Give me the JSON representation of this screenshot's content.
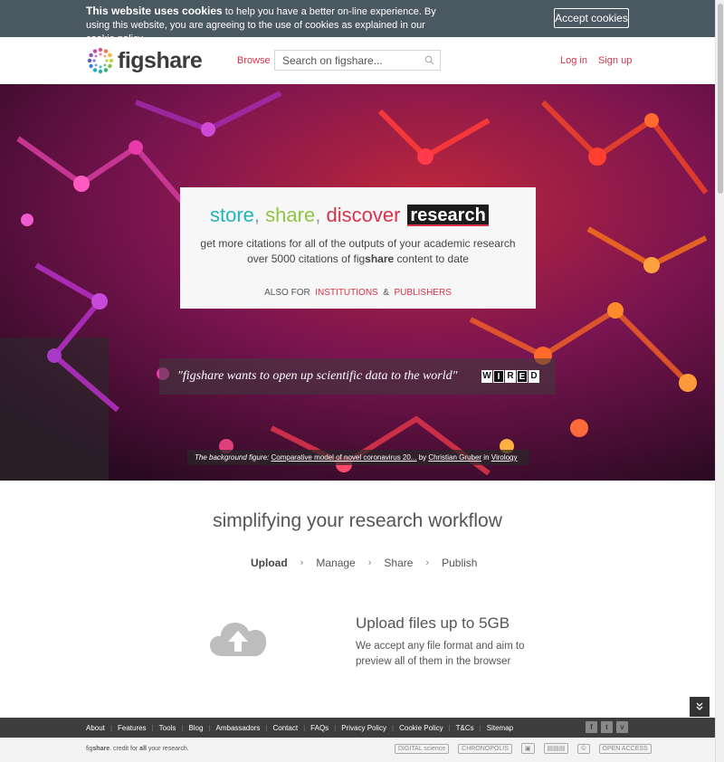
{
  "cookie": {
    "bold": "This website uses cookies",
    "text": " to help you have a better on-line experience. By using this website, you are agreeing to the use of cookies as explained in our ",
    "link": "cookie policy",
    "end": ".",
    "accept": "Accept cookies"
  },
  "header": {
    "logo": "figshare",
    "browse": "Browse",
    "search_placeholder": "Search on figshare...",
    "login": "Log in",
    "signup": "Sign up"
  },
  "hero": {
    "store": "store",
    "share": "share",
    "discover": "discover",
    "research": "research",
    "comma": ",",
    "line1": "get more citations for all of the outputs of your academic research",
    "line2_pre": "over 5000 citations of fig",
    "line2_bold": "share",
    "line2_post": " content to date",
    "also_for": "ALSO FOR",
    "institutions": "INSTITUTIONS",
    "amp": "&",
    "publishers": "PUBLISHERS",
    "quote": "\"figshare wants to open up scientific data to the world\"",
    "wired": [
      "W",
      "I",
      "R",
      "E",
      "D"
    ],
    "caption_label": "The background figure:",
    "caption_title": "Comparative model of novel coronavirus 20...",
    "caption_by": " by ",
    "caption_author": "Christian Gruber",
    "caption_in": " in ",
    "caption_category": "Virology"
  },
  "workflow": {
    "title": "simplifying your research workflow",
    "steps": [
      "Upload",
      "Manage",
      "Share",
      "Publish"
    ],
    "feature_title": "Upload files up to 5GB",
    "feature_desc": "We accept any file format and aim to preview all of them in the browser"
  },
  "footer": {
    "links": [
      "About",
      "Features",
      "Tools",
      "Blog",
      "Ambassadors",
      "Contact",
      "FAQs",
      "Privacy Policy",
      "Cookie Policy",
      "T&Cs",
      "Sitemap"
    ],
    "social": [
      "f",
      "t",
      "v"
    ],
    "credit_pre": "fig",
    "credit_bold": "share",
    "credit_mid": ". credit for ",
    "credit_all": "all",
    "credit_post": " your research.",
    "partners": [
      "DIGITAL science",
      "CHRONOPOLIS",
      "▣",
      "▤▤▤",
      "©",
      "OPEN ACCESS"
    ]
  },
  "icons": {
    "search": "search-icon",
    "upload": "cloud-upload-icon",
    "scroll": "chevron-double-down-icon"
  },
  "colors": {
    "accent": "#d8334a",
    "teal": "#20b5ba",
    "green": "#8ec63f",
    "cookie_bg": "#4a5861",
    "footer_bg": "#3d3d3d"
  }
}
